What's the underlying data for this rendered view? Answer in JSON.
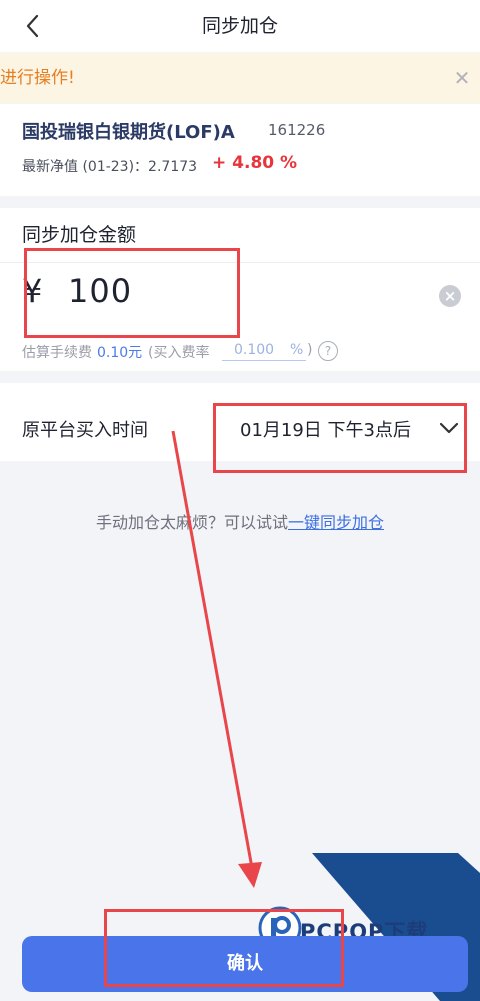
{
  "header": {
    "title": "同步加仓"
  },
  "notice": {
    "text": "进行操作!"
  },
  "fund": {
    "name": "国投瑞银白银期货(LOF)A",
    "code": "161226",
    "nav_label": "最新净值 (01-23)：2.7173",
    "nav_change": "+ 4.80 %"
  },
  "amount": {
    "title": "同步加仓金额",
    "currency": "¥",
    "value": "100",
    "fee_label": "估算手续费",
    "fee_value": "0.10元",
    "rate_label": "(买入费率",
    "rate_value": "0.100",
    "rate_pct": "%",
    "rate_close": ")"
  },
  "time": {
    "label": "原平台买入时间",
    "value": "01月19日  下午3点后"
  },
  "hint": {
    "text": "手动加仓太麻烦？可以试试",
    "link": "一键同步加仓"
  },
  "confirm": {
    "label": "确认"
  },
  "watermark": {
    "text": "PCPOP下载"
  },
  "colors": {
    "accent": "#4a74ea",
    "up": "#e8353b",
    "annotation": "#e8464b"
  }
}
